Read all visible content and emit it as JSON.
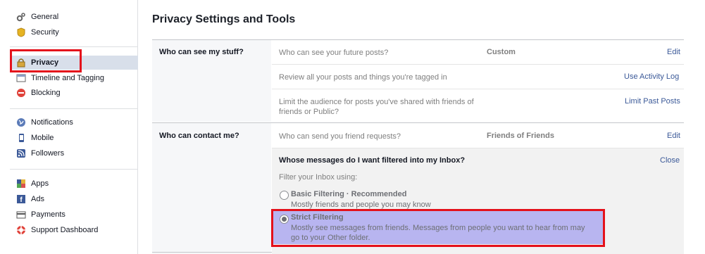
{
  "sidebar": {
    "group1": [
      {
        "label": "General",
        "icon": "gear-icon"
      },
      {
        "label": "Security",
        "icon": "badge-icon"
      }
    ],
    "group2": [
      {
        "label": "Privacy",
        "icon": "lock-icon",
        "active": true
      },
      {
        "label": "Timeline and Tagging",
        "icon": "timeline-icon"
      },
      {
        "label": "Blocking",
        "icon": "block-icon"
      }
    ],
    "group3": [
      {
        "label": "Notifications",
        "icon": "globe-icon"
      },
      {
        "label": "Mobile",
        "icon": "mobile-icon"
      },
      {
        "label": "Followers",
        "icon": "rss-icon"
      }
    ],
    "group4": [
      {
        "label": "Apps",
        "icon": "apps-icon"
      },
      {
        "label": "Ads",
        "icon": "ads-icon"
      },
      {
        "label": "Payments",
        "icon": "card-icon"
      },
      {
        "label": "Support Dashboard",
        "icon": "lifebuoy-icon"
      }
    ]
  },
  "main": {
    "title": "Privacy Settings and Tools",
    "sections": [
      {
        "label": "Who can see my stuff?",
        "rows": [
          {
            "question": "Who can see your future posts?",
            "value": "Custom",
            "action": "Edit"
          },
          {
            "question": "Review all your posts and things you're tagged in",
            "value": "",
            "action": "Use Activity Log"
          },
          {
            "question": "Limit the audience for posts you've shared with friends of friends or Public?",
            "value": "",
            "action": "Limit Past Posts"
          }
        ]
      },
      {
        "label": "Who can contact me?",
        "rows": [
          {
            "question": "Who can send you friend requests?",
            "value": "Friends of Friends",
            "action": "Edit"
          }
        ]
      }
    ],
    "filter_panel": {
      "title": "Whose messages do I want filtered into my Inbox?",
      "close": "Close",
      "subtitle": "Filter your Inbox using:",
      "options": [
        {
          "title": "Basic Filtering · Recommended",
          "desc": "Mostly friends and people you may know",
          "selected": false
        },
        {
          "title": "Strict Filtering",
          "desc": "Mostly see messages from friends. Messages from people you want to hear from may go to your Other folder.",
          "selected": true
        }
      ]
    }
  },
  "colors": {
    "link": "#3b5998",
    "highlight": "#e4111b",
    "active_bg": "#d8dfea",
    "selection_bg": "#b8b5f0"
  }
}
